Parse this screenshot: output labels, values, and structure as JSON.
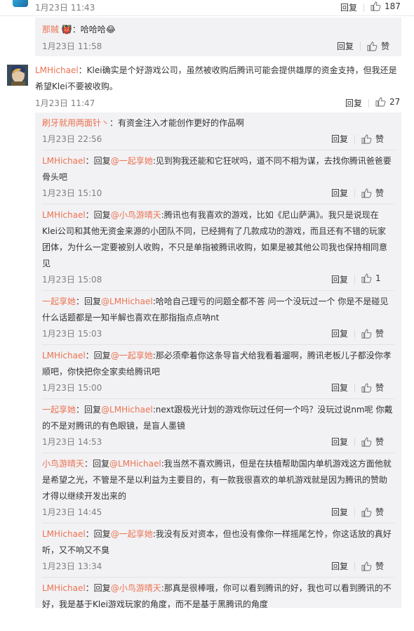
{
  "top": {
    "time": "1月23日 11:43",
    "reply": "回复",
    "likes": "187"
  },
  "first_sub": {
    "user": "那贼",
    "emoji": "👹",
    "text": "：哈哈哈😂",
    "time": "1月23日 11:58",
    "reply": "回复",
    "like": "赞"
  },
  "main": {
    "user": "LMHichael",
    "text1": "：Klei确实是个好游戏公司，虽然被收购后腾讯可能会提供雄厚的资金支持，但我还是",
    "text2": "希望Klei不要被收购。",
    "time": "1月23日 11:47",
    "reply": "回复",
    "likes": "27"
  },
  "replies": [
    {
      "user": "刷牙就用两面针丶",
      "lines": [
        "：有资金注入才能创作更好的作品啊"
      ],
      "time": "1月23日 22:56",
      "reply": "回复",
      "like": "赞"
    },
    {
      "user": "LMHichael",
      "prefix": "：回复",
      "mention": "@一起享她",
      "lines": [
        ":见到狗我还能和它狂吠吗，道不同不相为谋，去找你腾讯爸爸要",
        "骨头吧"
      ],
      "time": "1月23日 15:10",
      "reply": "回复",
      "like": "赞"
    },
    {
      "user": "LMHichael",
      "prefix": "：回复",
      "mention": "@小鸟游晴天",
      "lines": [
        ":腾讯也有我喜欢的游戏，比如《尼山萨满》。我只是说现在",
        "Klei公司和其他无资金来源的小团队不同，已经拥有了几款成功的游戏，而且还有不错的玩家",
        "团体，为什么一定要被别人收购，不只是单指被腾讯收购，如果是被其他公司我也保持相同意",
        "见"
      ],
      "time": "1月23日 15:08",
      "reply": "回复",
      "like": "1"
    },
    {
      "user": "一起享她",
      "prefix": "：回复",
      "mention": "@LMHichael",
      "lines": [
        ":哈哈自己理亏的问题全都不答 问一个没玩过一个 你是不是碰见",
        "什么话题都是一知半解也喜欢在那指指点点呐nt"
      ],
      "time": "1月23日 15:03",
      "reply": "回复",
      "like": "赞"
    },
    {
      "user": "LMHichael",
      "prefix": "：回复",
      "mention": "@一起享她",
      "lines": [
        ":那必须牵着你这条导盲犬给我看着遛啊，腾讯老板儿子都没你孝",
        "顺吧，你快把你全家卖给腾讯吧"
      ],
      "time": "1月23日 15:00",
      "reply": "回复",
      "like": "赞"
    },
    {
      "user": "一起享她",
      "prefix": "：回复",
      "mention": "@LMHichael",
      "lines": [
        ":next跟极光计划的游戏你玩过任何一个吗？没玩过说nm呢 你戴",
        "的不是对腾讯的有色眼镜，是盲人墨镜"
      ],
      "time": "1月23日 14:53",
      "reply": "回复",
      "like": "赞"
    },
    {
      "user": "小鸟游晴天",
      "prefix": "：回复",
      "mention": "@LMHichael",
      "lines": [
        ":我当然不喜欢腾讯，但是在扶植帮助国内单机游戏这方面他就",
        "是希望之光，不管是不是以利益为主要目的，有一款我很喜欢的单机游戏就是因为腾讯的赞助",
        "才得以继续开发出来的"
      ],
      "time": "1月23日 14:45",
      "reply": "回复",
      "like": "赞"
    },
    {
      "user": "LMHichael",
      "prefix": "：回复",
      "mention": "@一起享她",
      "lines": [
        ":我没有反对资本，但也没有像你一样摇尾乞怜，你这话放的真好",
        "听，又不响又不臭"
      ],
      "time": "1月23日 13:34",
      "reply": "回复",
      "like": "赞"
    },
    {
      "user": "LMHichael",
      "prefix": "：回复",
      "mention": "@小鸟游晴天",
      "lines": [
        ":那真是很棒哦，你可以看到腾讯的好，我也可以看到腾讯的不",
        "好，我是基于Klei游戏玩家的角度，而不是基于黑腾讯的角度"
      ],
      "time": "",
      "reply": "",
      "like": ""
    }
  ]
}
